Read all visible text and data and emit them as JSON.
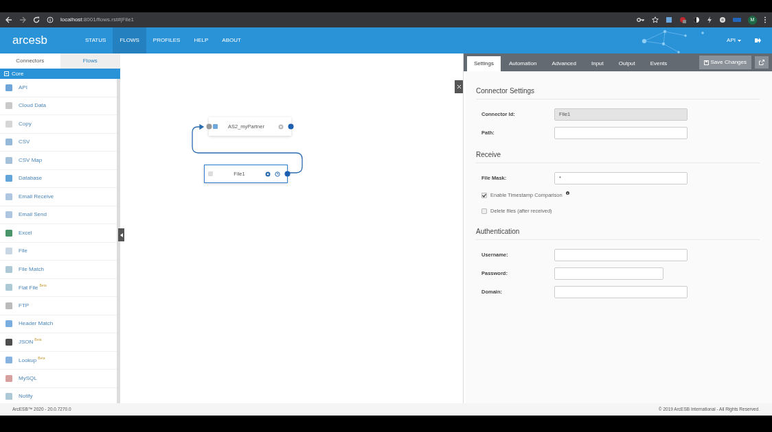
{
  "browser": {
    "url_host": "localhost",
    "url_rest": ":8001/flows.rst#|File1",
    "profile": "M"
  },
  "navbar": {
    "logo": "arcesb",
    "items": [
      {
        "label": "STATUS",
        "selected": false
      },
      {
        "label": "FLOWS",
        "selected": true
      },
      {
        "label": "PROFILES",
        "selected": false
      },
      {
        "label": "HELP",
        "selected": false
      },
      {
        "label": "ABOUT",
        "selected": false
      }
    ],
    "api_menu": "API"
  },
  "sidebar": {
    "tabs": [
      {
        "label": "Connectors",
        "selected": true
      },
      {
        "label": "Flows",
        "selected": false
      }
    ],
    "group": {
      "label": "Core",
      "expanded": true
    },
    "items": [
      {
        "label": "API"
      },
      {
        "label": "Cloud Data"
      },
      {
        "label": "Copy"
      },
      {
        "label": "CSV"
      },
      {
        "label": "CSV Map"
      },
      {
        "label": "Database"
      },
      {
        "label": "Email Receive"
      },
      {
        "label": "Email Send"
      },
      {
        "label": "Excel"
      },
      {
        "label": "File"
      },
      {
        "label": "File Match"
      },
      {
        "label": "Flat File",
        "badge": "Beta"
      },
      {
        "label": "FTP"
      },
      {
        "label": "Header Match"
      },
      {
        "label": "JSON",
        "badge": "Beta"
      },
      {
        "label": "Lookup",
        "badge": "Beta"
      },
      {
        "label": "MySQL"
      },
      {
        "label": "Notify"
      }
    ]
  },
  "canvas": {
    "nodes": [
      {
        "label": "AS2_myPartner",
        "selected": false
      },
      {
        "label": "File1",
        "selected": true
      }
    ]
  },
  "panel": {
    "tabs": [
      {
        "label": "Settings",
        "selected": true
      },
      {
        "label": "Automation",
        "selected": false
      },
      {
        "label": "Advanced",
        "selected": false
      },
      {
        "label": "Input",
        "selected": false
      },
      {
        "label": "Output",
        "selected": false
      },
      {
        "label": "Events",
        "selected": false
      }
    ],
    "save_button": "Save Changes",
    "sections": [
      {
        "title": "Connector Settings",
        "fields": [
          {
            "kind": "text",
            "label": "Connector Id:",
            "value": "File1",
            "disabled": true
          },
          {
            "kind": "text",
            "label": "Path:",
            "disabled": false
          }
        ]
      },
      {
        "title": "Receive",
        "fields": [
          {
            "kind": "text",
            "label": "File Mask:",
            "value": "*",
            "disabled": false
          },
          {
            "kind": "checkbox",
            "label": "Enable Timestamp Comparison",
            "checked": true,
            "info": true
          },
          {
            "kind": "checkbox",
            "label": "Delete files (after received)",
            "checked": false,
            "info": false
          }
        ]
      },
      {
        "title": "Authentication",
        "fields": [
          {
            "kind": "text",
            "label": "Username:",
            "disabled": false
          },
          {
            "kind": "password",
            "label": "Password:",
            "disabled": false
          },
          {
            "kind": "text",
            "label": "Domain:",
            "disabled": false
          }
        ]
      }
    ]
  },
  "footer": {
    "left": "ArcESB™ 2020 - 20.0.7270.0",
    "right": "© 2019 ArcESB International - All Rights Reserved."
  }
}
